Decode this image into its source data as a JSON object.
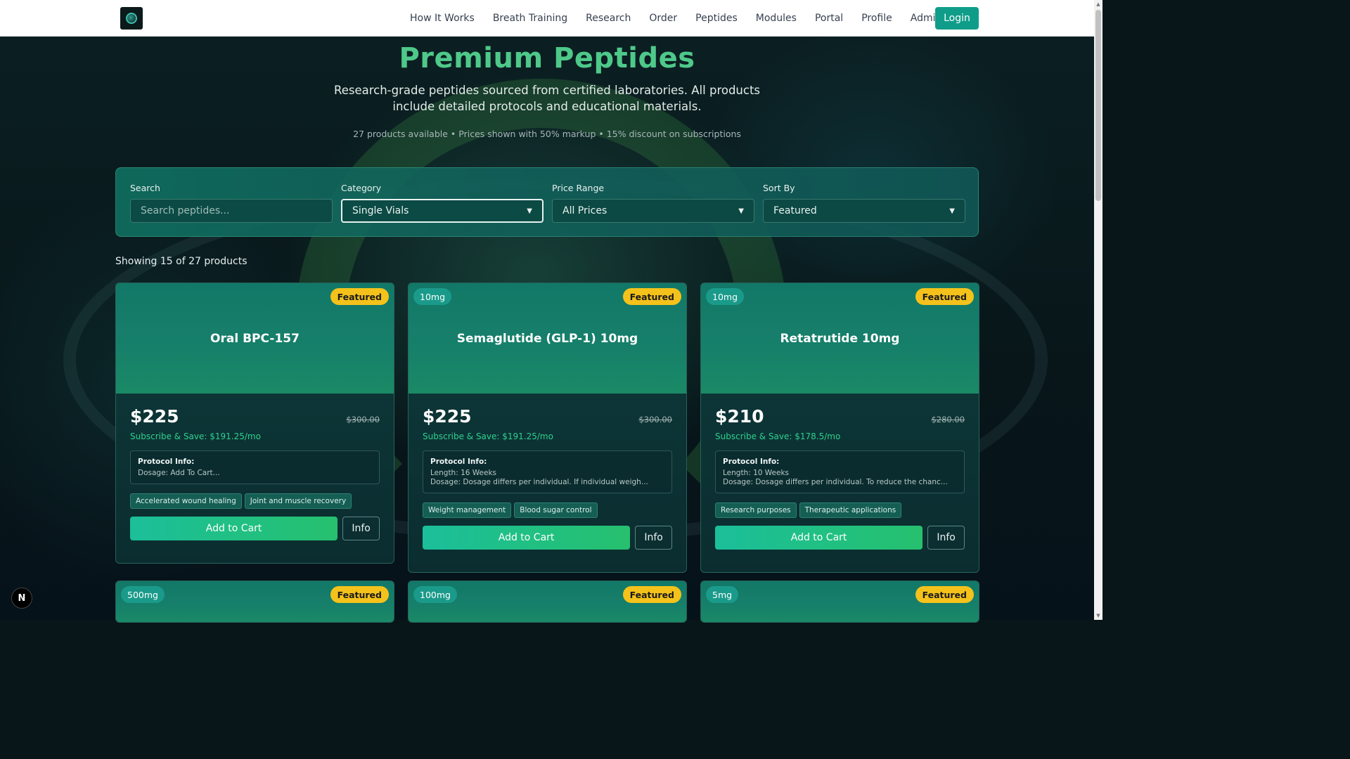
{
  "nav": {
    "links": [
      "How It Works",
      "Breath Training",
      "Research",
      "Order",
      "Peptides",
      "Modules",
      "Portal",
      "Profile",
      "Admin"
    ],
    "login_label": "Login"
  },
  "hero": {
    "title": "Premium Peptides",
    "subtitle": "Research-grade peptides sourced from certified laboratories. All products include detailed protocols and educational materials.",
    "meta": "27 products available • Prices shown with 50% markup • 15% discount on subscriptions"
  },
  "filters": {
    "search_label": "Search",
    "search_placeholder": "Search peptides...",
    "category_label": "Category",
    "category_value": "Single Vials",
    "price_label": "Price Range",
    "price_value": "All Prices",
    "sort_label": "Sort By",
    "sort_value": "Featured"
  },
  "showing": "Showing 15 of 27 products",
  "products": [
    {
      "size": "",
      "featured": "Featured",
      "name": "Oral BPC-157",
      "price": "$225",
      "old_price": "$300.00",
      "subscribe": "Subscribe & Save: $191.25/mo",
      "protocol_title": "Protocol Info:",
      "protocol_lines": [
        "Dosage: Add To Cart..."
      ],
      "tags": [
        "Accelerated wound healing",
        "Joint and muscle recovery"
      ],
      "cart_label": "Add to Cart",
      "info_label": "Info"
    },
    {
      "size": "10mg",
      "featured": "Featured",
      "name": "Semaglutide (GLP-1) 10mg",
      "price": "$225",
      "old_price": "$300.00",
      "subscribe": "Subscribe & Save: $191.25/mo",
      "protocol_title": "Protocol Info:",
      "protocol_lines": [
        "Length: 16 Weeks",
        "Dosage: Dosage differs per individual. If individual weigh..."
      ],
      "tags": [
        "Weight management",
        "Blood sugar control"
      ],
      "cart_label": "Add to Cart",
      "info_label": "Info"
    },
    {
      "size": "10mg",
      "featured": "Featured",
      "name": "Retatrutide 10mg",
      "price": "$210",
      "old_price": "$280.00",
      "subscribe": "Subscribe & Save: $178.5/mo",
      "protocol_title": "Protocol Info:",
      "protocol_lines": [
        "Length: 10 Weeks",
        "Dosage: Dosage differs per individual. To reduce the chanc..."
      ],
      "tags": [
        "Research purposes",
        "Therapeutic applications"
      ],
      "cart_label": "Add to Cart",
      "info_label": "Info"
    }
  ],
  "next_row": [
    {
      "size": "500mg",
      "featured": "Featured"
    },
    {
      "size": "100mg",
      "featured": "Featured"
    },
    {
      "size": "5mg",
      "featured": "Featured"
    }
  ],
  "dev_badge": "N",
  "colors": {
    "accent": "#0f9d8a",
    "title_green": "#4ec98a",
    "featured_yellow": "#f4c21b",
    "subscribe_green": "#2ed18f"
  }
}
